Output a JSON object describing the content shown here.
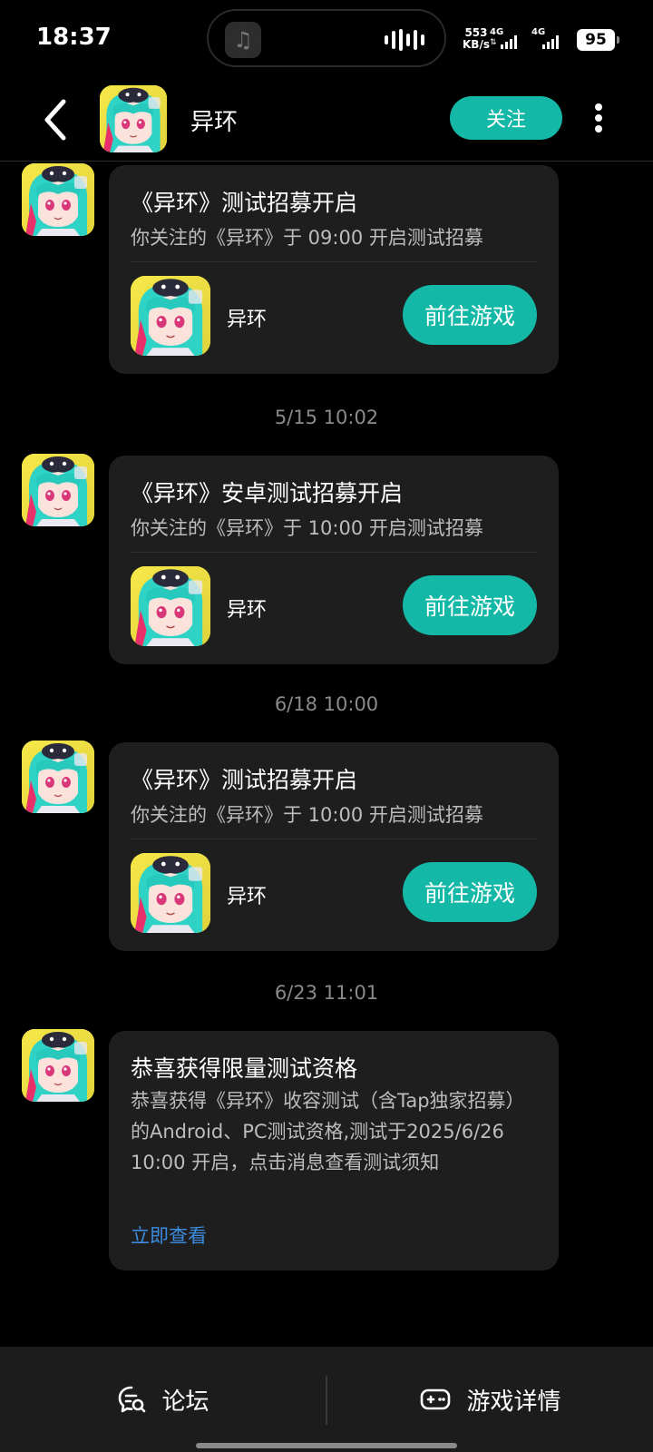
{
  "status_bar": {
    "time": "18:37",
    "net_speed_value": "553",
    "net_speed_unit": "KB/s",
    "sim1_label": "4G",
    "sim2_label": "4G",
    "battery": "95",
    "music_icon": "music-note-icon",
    "wave_icon": "audio-wave-icon"
  },
  "header": {
    "title": "异环",
    "follow_label": "关注",
    "back_icon": "chevron-left-icon",
    "more_icon": "more-vertical-icon"
  },
  "messages": [
    {
      "title": "《异环》测试招募开启",
      "desc": "你关注的《异环》于 09:00 开启测试招募",
      "game_name": "异环",
      "button_label": "前往游戏"
    },
    {
      "timestamp": "5/15  10:02",
      "title": "《异环》安卓测试招募开启",
      "desc": "你关注的《异环》于 10:00 开启测试招募",
      "game_name": "异环",
      "button_label": "前往游戏"
    },
    {
      "timestamp": "6/18  10:00",
      "title": "《异环》测试招募开启",
      "desc": "你关注的《异环》于 10:00 开启测试招募",
      "game_name": "异环",
      "button_label": "前往游戏"
    },
    {
      "timestamp": "6/23  11:01",
      "title": "恭喜获得限量测试资格",
      "desc": "恭喜获得《异环》收容测试（含Tap独家招募）的Android、PC测试资格,测试于2025/6/26 10:00 开启，点击消息查看测试须知",
      "link_label": "立即查看"
    }
  ],
  "bottom_bar": {
    "forum_label": "论坛",
    "forum_icon": "forum-chat-icon",
    "details_label": "游戏详情",
    "details_icon": "gamepad-icon"
  },
  "colors": {
    "accent": "#14b8a6",
    "link": "#3b8ce0",
    "card_bg": "#1e1e1e",
    "background": "#000000"
  }
}
